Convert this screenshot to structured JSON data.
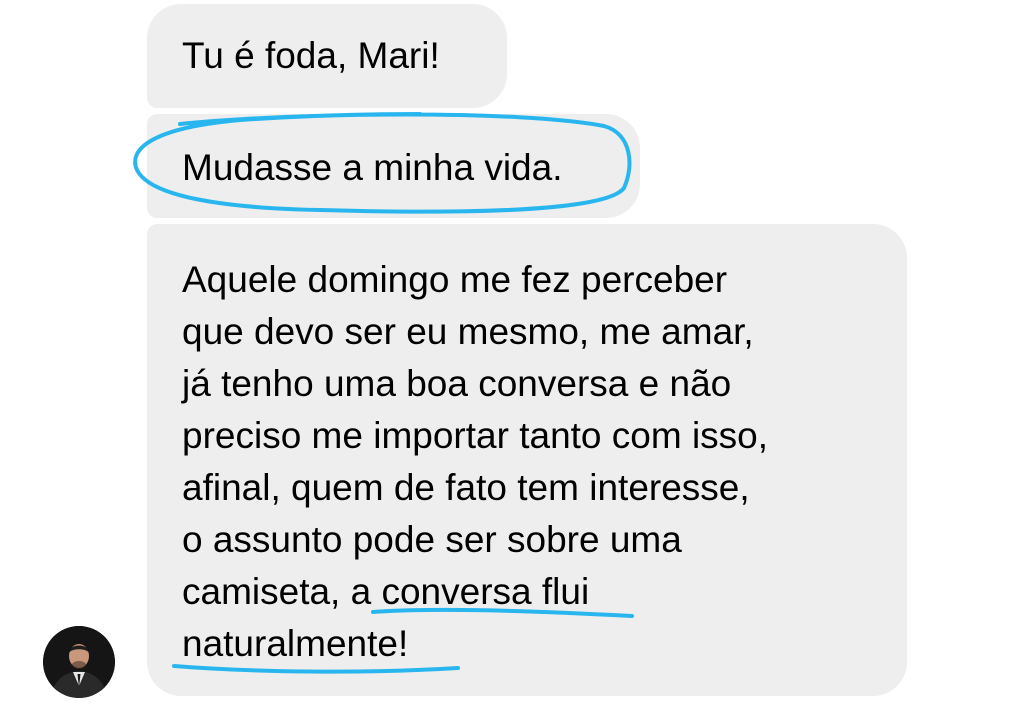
{
  "conversation": {
    "messages": [
      {
        "lines": [
          "Tu é foda, Mari!"
        ]
      },
      {
        "lines": [
          "Mudasse a minha vida."
        ]
      },
      {
        "lines": [
          "Aquele domingo me fez perceber",
          "que devo ser eu mesmo, me amar,",
          "já tenho uma boa conversa e não",
          "preciso me importar tanto com isso,",
          "afinal, quem de fato tem interesse,",
          "o assunto pode ser sobre uma",
          "camiseta, a conversa flui",
          "naturalmente!"
        ]
      }
    ]
  },
  "theme": {
    "bubble_color": "#eeeeef",
    "annotation_color": "#29b6ee"
  },
  "icons": {
    "avatar": "profile-photo-icon"
  }
}
